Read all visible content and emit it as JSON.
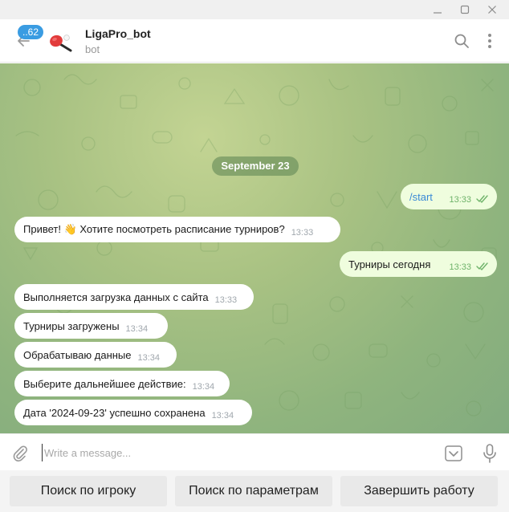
{
  "window": {
    "minimize_icon": "minimize-icon",
    "maximize_icon": "maximize-icon",
    "close_icon": "close-icon"
  },
  "header": {
    "unread_count": "..62",
    "title": "LigaPro_bot",
    "status": "bot",
    "back_icon": "arrow-left-icon",
    "search_icon": "search-icon",
    "more_icon": "more-vertical-icon"
  },
  "chat": {
    "date_separator": "September 23",
    "messages": [
      {
        "direction": "out",
        "text": "/start",
        "time": "13:33",
        "is_command": true
      },
      {
        "direction": "in",
        "text": "Привет! 👋 Хотите посмотреть расписание турниров?",
        "time": "13:33"
      },
      {
        "direction": "out",
        "text": "Турниры сегодня",
        "time": "13:33"
      },
      {
        "direction": "in",
        "text": "Выполняется загрузка данных с сайта",
        "time": "13:33"
      },
      {
        "direction": "in",
        "text": "Турниры загружены",
        "time": "13:34"
      },
      {
        "direction": "in",
        "text": "Обрабатываю данные",
        "time": "13:34"
      },
      {
        "direction": "in",
        "text": "Выберите дальнейшее действие:",
        "time": "13:34"
      },
      {
        "direction": "in",
        "text": "Дата '2024-09-23' успешно  сохранена",
        "time": "13:34"
      }
    ]
  },
  "composer": {
    "placeholder": "Write a message...",
    "attach_icon": "paperclip-icon",
    "keyboard_icon": "keyboard-toggle-icon",
    "mic_icon": "microphone-icon"
  },
  "reply_keyboard": [
    {
      "label": "Поиск по игроку"
    },
    {
      "label": "Поиск по параметрам"
    },
    {
      "label": "Завершить работу"
    }
  ],
  "colors": {
    "accent": "#3a9ce2",
    "outgoing_bubble": "#effdde",
    "incoming_bubble": "#ffffff",
    "read_check": "#6fb36a",
    "chat_background": "#a9c283"
  }
}
